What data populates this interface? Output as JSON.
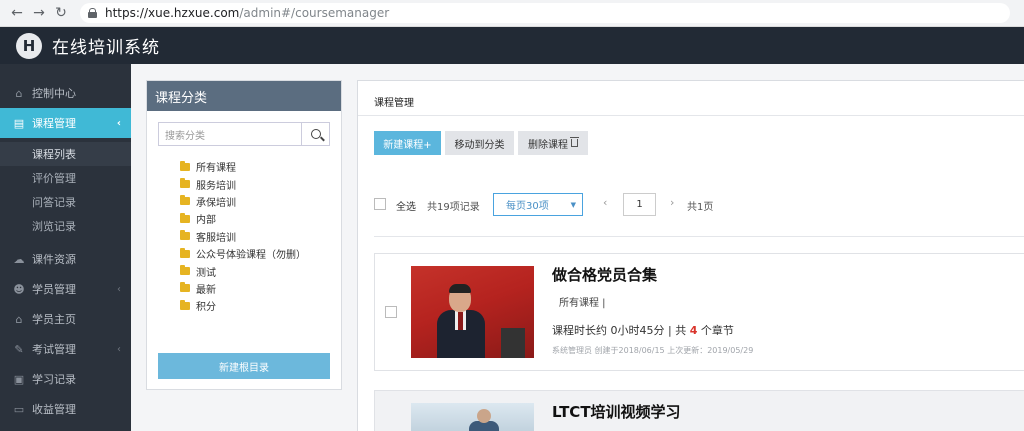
{
  "browser": {
    "url_host": "https://xue.hzxue.com",
    "url_path": "/admin#/coursemanager",
    "back_icon": "←",
    "forward_icon": "→",
    "reload_icon": "↻"
  },
  "header": {
    "logo_text": "H",
    "title": "在线培训系统"
  },
  "sidebar": {
    "items": [
      {
        "label": "控制中心",
        "icon": "⌂"
      },
      {
        "label": "课程管理",
        "icon": "▤",
        "chevron": "‹"
      },
      {
        "label": "课件资源",
        "icon": "☁"
      },
      {
        "label": "学员管理",
        "icon": "☻",
        "chevron": "‹"
      },
      {
        "label": "学员主页",
        "icon": "⌂"
      },
      {
        "label": "考试管理",
        "icon": "✎",
        "chevron": "‹"
      },
      {
        "label": "学习记录",
        "icon": "▣"
      },
      {
        "label": "收益管理",
        "icon": "▭"
      }
    ],
    "sub_items": [
      {
        "label": "课程列表"
      },
      {
        "label": "评价管理"
      },
      {
        "label": "问答记录"
      },
      {
        "label": "浏览记录"
      }
    ]
  },
  "category_panel": {
    "title": "课程分类",
    "search_placeholder": "搜索分类",
    "tree": [
      {
        "label": "所有课程"
      },
      {
        "label": "服务培训"
      },
      {
        "label": "承保培训"
      },
      {
        "label": "内部"
      },
      {
        "label": "客服培训"
      },
      {
        "label": "公众号体验课程（勿删）"
      },
      {
        "label": "测试"
      },
      {
        "label": "最新"
      },
      {
        "label": "积分"
      }
    ],
    "new_root_label": "新建根目录"
  },
  "course_panel": {
    "title": "课程管理",
    "toolbar": {
      "new_label": "新建课程+",
      "move_label": "移动到分类",
      "delete_label": "删除课程"
    },
    "list_controls": {
      "select_all": "全选",
      "total_records": "共19项记录",
      "per_page": "每页30项",
      "prev": "‹",
      "page": "1",
      "next": "›",
      "total_pages": "共1页"
    },
    "courses": [
      {
        "title": "做合格党员合集",
        "category": "所有课程 |",
        "duration_prefix": "课程时长约 0小时45分 | 共 ",
        "chapters": "4",
        "duration_suffix": " 个章节",
        "meta": "系统管理员  创建于2018/06/15 上次更新：2019/05/29"
      },
      {
        "title": "LTCT培训视频学习"
      }
    ]
  }
}
